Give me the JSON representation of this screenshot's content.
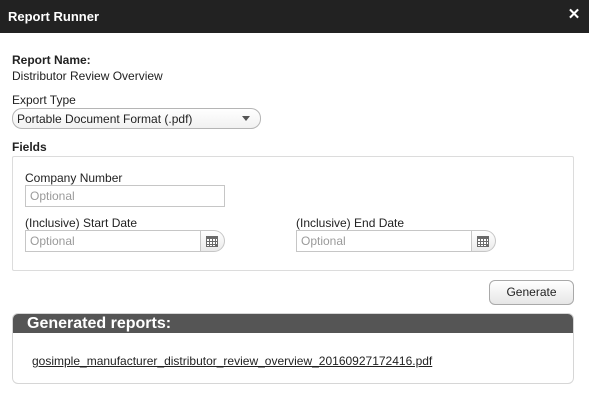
{
  "window": {
    "title": "Report Runner",
    "close_icon": "close-icon"
  },
  "report": {
    "name_label": "Report Name:",
    "name_value": "Distributor Review Overview"
  },
  "export": {
    "label": "Export Type",
    "selected": "Portable Document Format (.pdf)"
  },
  "fields": {
    "legend": "Fields",
    "company_number": {
      "label": "Company Number",
      "placeholder": "Optional"
    },
    "start_date": {
      "label": "(Inclusive) Start Date",
      "placeholder": "Optional"
    },
    "end_date": {
      "label": "(Inclusive) End Date",
      "placeholder": "Optional"
    }
  },
  "actions": {
    "generate_label": "Generate"
  },
  "generated": {
    "header": "Generated reports:",
    "files": [
      "gosimple_manufacturer_distributor_review_overview_20160927172416.pdf"
    ]
  },
  "colors": {
    "titlebar": "#222222",
    "panel_header": "#555555"
  }
}
